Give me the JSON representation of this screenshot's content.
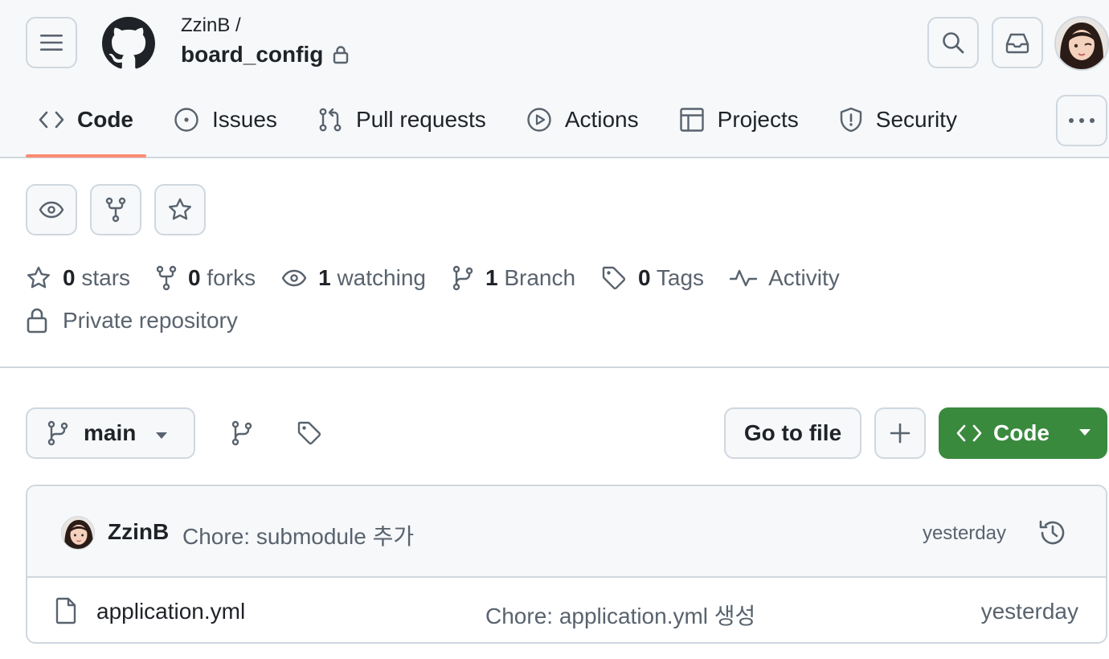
{
  "header": {
    "owner": "ZzinB /",
    "repo_name": "board_config",
    "icons": [
      "menu-icon",
      "github-logo",
      "lock-icon",
      "search-icon",
      "inbox-icon",
      "avatar"
    ]
  },
  "tabs": [
    {
      "label": "Code",
      "icon": "code-icon",
      "active": true
    },
    {
      "label": "Issues",
      "icon": "issue-icon"
    },
    {
      "label": "Pull requests",
      "icon": "pull-request-icon"
    },
    {
      "label": "Actions",
      "icon": "play-icon"
    },
    {
      "label": "Projects",
      "icon": "table-icon"
    },
    {
      "label": "Security",
      "icon": "shield-icon"
    }
  ],
  "repo_actions": [
    "eye-icon",
    "fork-icon",
    "star-icon"
  ],
  "stats": {
    "stars_count": "0",
    "stars_label": "stars",
    "forks_count": "0",
    "forks_label": "forks",
    "watching_count": "1",
    "watching_label": "watching",
    "branch_count": "1",
    "branch_label": "Branch",
    "tags_count": "0",
    "tags_label": "Tags",
    "activity_label": "Activity"
  },
  "visibility": "Private repository",
  "toolbar": {
    "branch": "main",
    "go_to_file": "Go to file",
    "code_button": "Code"
  },
  "latest_commit": {
    "author": "ZzinB",
    "message": "Chore: submodule 추가",
    "time": "yesterday"
  },
  "files": [
    {
      "name": "application.yml",
      "message": "Chore: application.yml 생성",
      "time": "yesterday"
    }
  ],
  "colors": {
    "accent_underline": "#fd8c73",
    "code_button": "#3a8a3e",
    "header_bg": "#f6f8fa",
    "border": "#d0d7de",
    "muted_text": "#59636e"
  }
}
